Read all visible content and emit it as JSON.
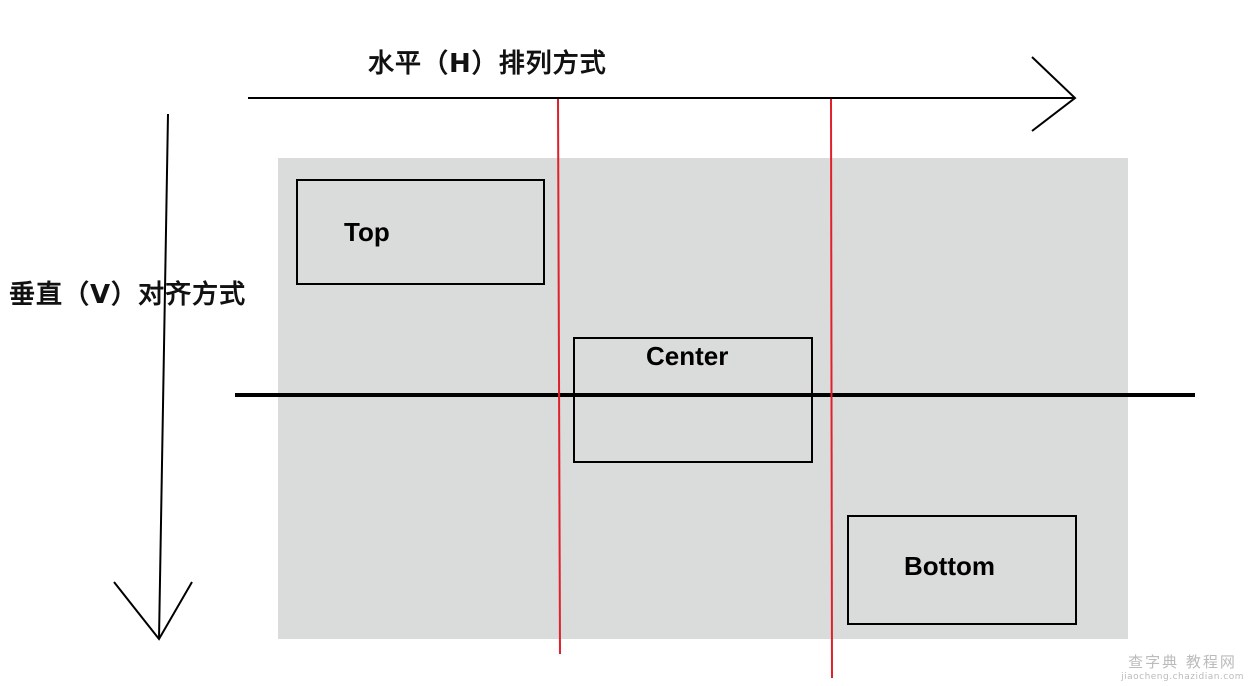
{
  "diagram": {
    "horizontal_axis_label": "水平（H）排列方式",
    "vertical_axis_label": "垂直（V）对齐方式",
    "boxes": [
      {
        "id": "top",
        "label": "Top"
      },
      {
        "id": "center",
        "label": "Center"
      },
      {
        "id": "bottom",
        "label": "Bottom"
      }
    ],
    "colors": {
      "container_fill": "#dadbdb",
      "guide_line": "#e0202a",
      "axis_line": "#000000",
      "box_border": "#000000"
    }
  },
  "watermark": {
    "line1": "查字典 教程网",
    "line2": "jiaocheng.chazidian.com"
  }
}
